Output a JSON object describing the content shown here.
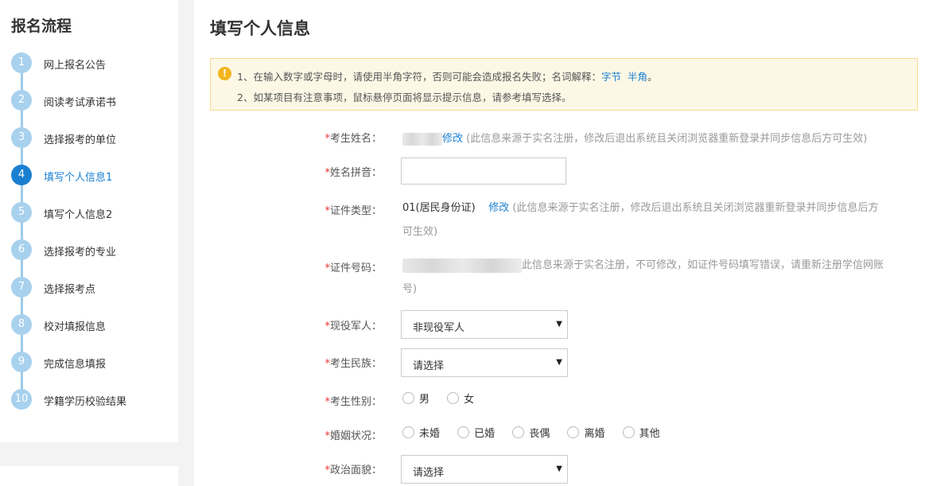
{
  "sidebar": {
    "title": "报名流程",
    "steps": [
      {
        "num": "1",
        "label": "网上报名公告"
      },
      {
        "num": "2",
        "label": "阅读考试承诺书"
      },
      {
        "num": "3",
        "label": "选择报考的单位"
      },
      {
        "num": "4",
        "label": "填写个人信息1",
        "active": true
      },
      {
        "num": "5",
        "label": "填写个人信息2"
      },
      {
        "num": "6",
        "label": "选择报考的专业"
      },
      {
        "num": "7",
        "label": "选择报考点"
      },
      {
        "num": "8",
        "label": "校对填报信息"
      },
      {
        "num": "9",
        "label": "完成信息填报"
      },
      {
        "num": "10",
        "label": "学籍学历校验结果"
      }
    ]
  },
  "main": {
    "title": "填写个人信息",
    "notice": {
      "line1_prefix": "1、在输入数字或字母时，请使用半角字符，否则可能会造成报名失败；名词解释：",
      "link1": "字节",
      "link2": "半角",
      "line1_suffix": "。",
      "line2": "2、如某项目有注意事项，鼠标悬停页面将显示提示信息，请参考填写选择。"
    },
    "form": {
      "required_mark": "*",
      "name": {
        "label": "考生姓名：",
        "edit": "修改",
        "hint": "(此信息来源于实名注册，修改后退出系统且关闭浏览器重新登录并同步信息后方可生效)"
      },
      "pinyin": {
        "label": "姓名拼音："
      },
      "id_type": {
        "label": "证件类型：",
        "value": "01(居民身份证)",
        "edit": "修改",
        "hint_l1": "(此信息来源于实名注册，修改后退出系统且关闭浏览器重新登录并同步信息后方",
        "hint_l2": "可生效)"
      },
      "id_number": {
        "label": "证件号码：",
        "hint_l1": "此信息来源于实名注册，不可修改，如证件号码填写错误，请重新注册学信网账",
        "hint_l2": "号)"
      },
      "military": {
        "label": "现役军人：",
        "selected": "非现役军人"
      },
      "ethnicity": {
        "label": "考生民族：",
        "selected": "请选择"
      },
      "gender": {
        "label": "考生性别：",
        "options": [
          "男",
          "女"
        ]
      },
      "marital": {
        "label": "婚姻状况：",
        "options": [
          "未婚",
          "已婚",
          "丧偶",
          "离婚",
          "其他"
        ]
      },
      "political": {
        "label": "政治面貌：",
        "selected": "请选择"
      }
    }
  }
}
